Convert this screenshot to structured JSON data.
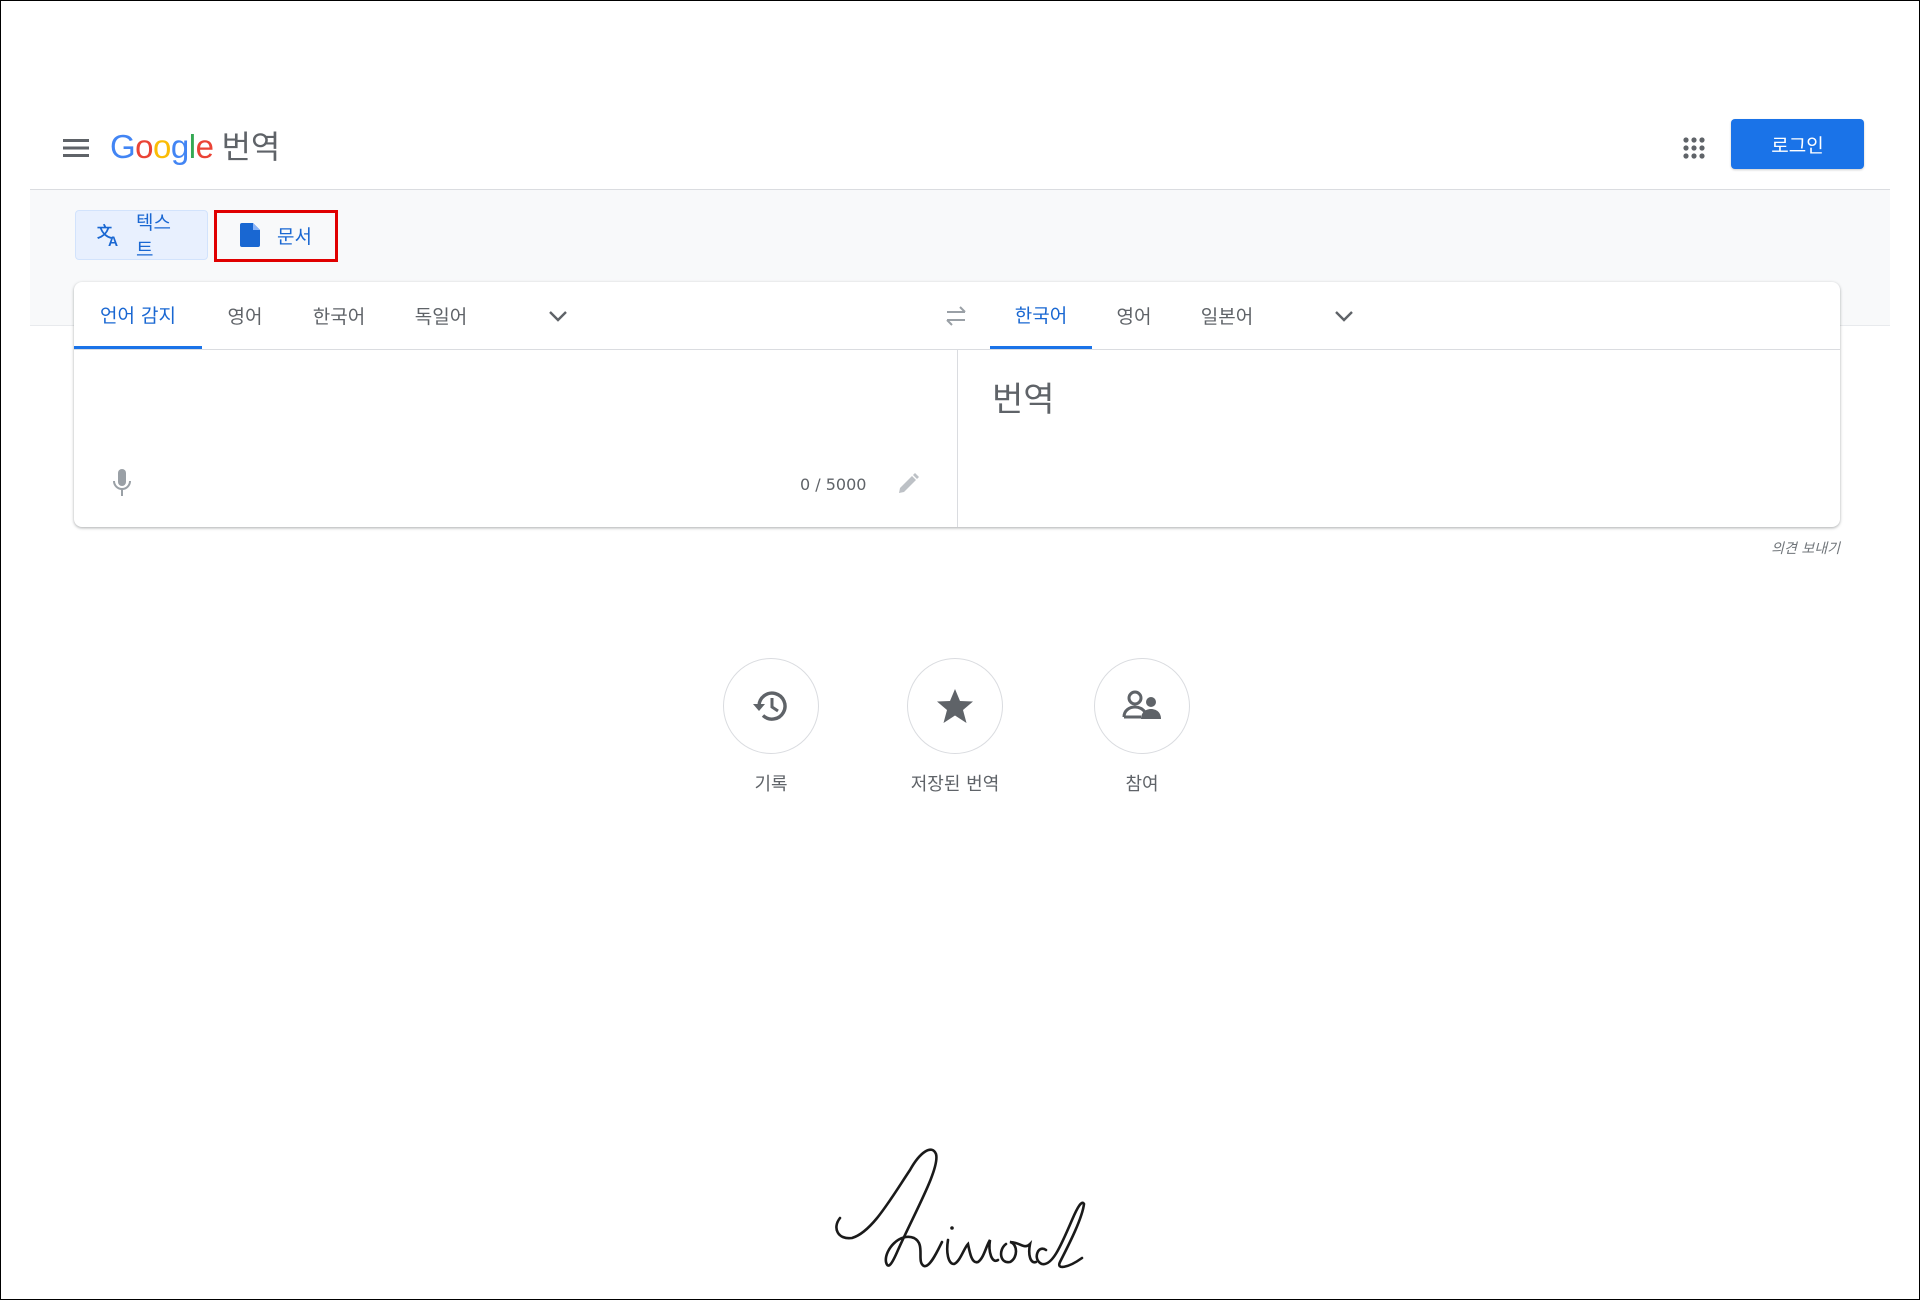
{
  "header": {
    "logo_letters": [
      {
        "char": "G",
        "color": "#4285f4"
      },
      {
        "char": "o",
        "color": "#ea4335"
      },
      {
        "char": "o",
        "color": "#fbbc05"
      },
      {
        "char": "g",
        "color": "#4285f4"
      },
      {
        "char": "l",
        "color": "#34a853"
      },
      {
        "char": "e",
        "color": "#ea4335"
      }
    ],
    "product_name": "번역",
    "login_label": "로그인",
    "menu_icon": "hamburger-menu-icon",
    "apps_icon": "apps-grid-icon"
  },
  "mode_tabs": {
    "text_label": "텍스트",
    "document_label": "문서",
    "text_icon": "translate-icon",
    "document_icon": "document-icon"
  },
  "source_languages": {
    "tabs": [
      "언어 감지",
      "영어",
      "한국어",
      "독일어"
    ],
    "active_index": 0
  },
  "target_languages": {
    "tabs": [
      "한국어",
      "영어",
      "일본어"
    ],
    "active_index": 0
  },
  "source": {
    "value": "",
    "counter": "0 / 5000"
  },
  "target": {
    "placeholder_text": "번역"
  },
  "feedback_label": "의견 보내기",
  "actions": [
    {
      "label": "기록",
      "icon": "history-icon"
    },
    {
      "label": "저장된 번역",
      "icon": "star-icon"
    },
    {
      "label": "참여",
      "icon": "community-icon"
    }
  ],
  "colors": {
    "accent": "#1a73e8",
    "active_tab_text": "#1967d2",
    "highlight_box": "#e00000"
  }
}
